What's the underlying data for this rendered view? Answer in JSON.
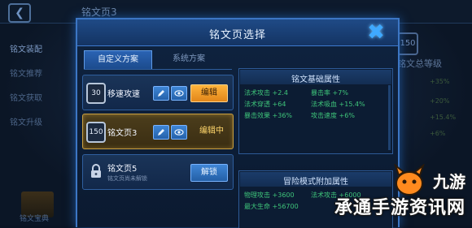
{
  "background": {
    "title": "铭文页3",
    "sidebar": [
      "铭文装配",
      "铭文推荐",
      "铭文获取",
      "铭文升级"
    ],
    "codex_label": "铭文宝典",
    "level": "150",
    "level_label": "铭文总等级",
    "right_values": [
      "+35%",
      "+20%",
      "+15.4%",
      "+6%"
    ]
  },
  "modal": {
    "title": "铭文页选择",
    "tabs": [
      "自定义方案",
      "系统方案"
    ],
    "schemes": [
      {
        "level": "30",
        "name": "移速攻速",
        "action": "编辑"
      },
      {
        "level": "150",
        "name": "铭文页3",
        "action": "编辑中"
      },
      {
        "name": "铭文页5",
        "sub": "铭文页尚未解锁",
        "action": "解锁"
      }
    ],
    "basic_attrs": {
      "title": "铭文基础属性",
      "items": [
        "法术攻击 +2.4",
        "暴击率 +7%",
        "法术穿透 +64",
        "法术吸血 +15.4%",
        "暴击效果 +36%",
        "攻击速度 +6%"
      ]
    },
    "adventure_attrs": {
      "title": "冒险模式附加属性",
      "items": [
        "物理攻击 +3600",
        "法术攻击 +6000",
        "最大生命 +56700"
      ]
    }
  },
  "watermark": {
    "logo": "九游",
    "text": "承通手游资讯网"
  }
}
